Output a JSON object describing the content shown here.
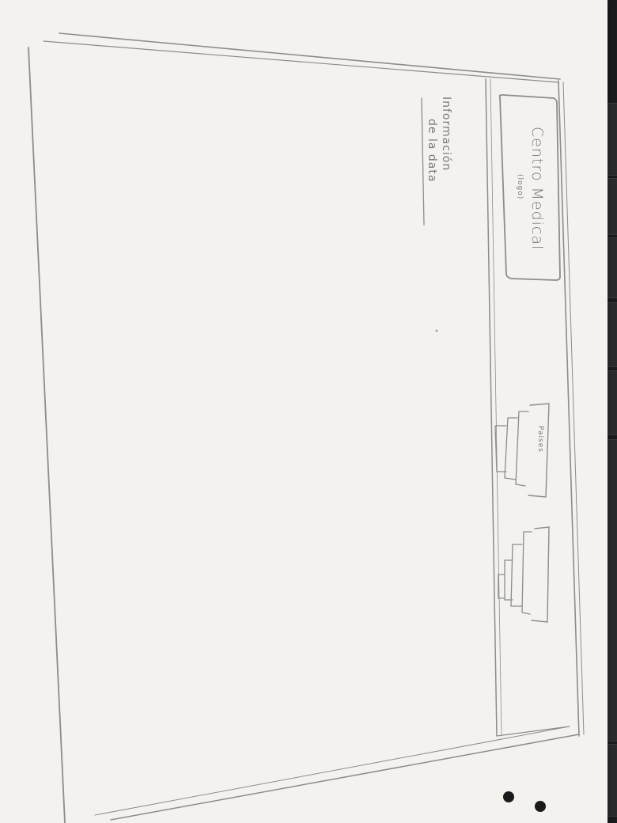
{
  "header": {
    "logo": {
      "label": "Centro Medical",
      "sublabel": "(logo)"
    },
    "nav_items": [
      {
        "label": "Paises",
        "icon": "stack-icon"
      },
      {
        "label": "",
        "icon": "stack-icon"
      }
    ]
  },
  "content": {
    "info_line1": "Información",
    "info_line2": "de la data"
  },
  "colors": {
    "pencil": "#8a8a8a",
    "paper": "#f3f2ee",
    "keyboard": "#1b1b1d"
  }
}
